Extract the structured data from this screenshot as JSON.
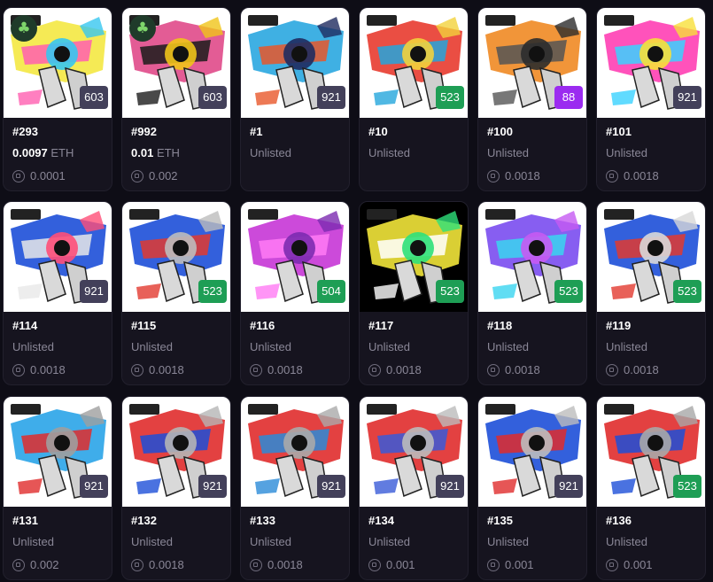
{
  "currency": "ETH",
  "colors": {
    "badge_gray": "#43405a",
    "badge_green": "#1e9e55",
    "badge_purple": "#9b2bf0",
    "accent_clover": "#7ed56b"
  },
  "cards": [
    {
      "id": "#293",
      "badge": "603",
      "badge_color": "gray",
      "price": "0.0097",
      "listed": true,
      "offer": "0.0001",
      "clover": true
    },
    {
      "id": "#992",
      "badge": "603",
      "badge_color": "gray",
      "price": "0.01",
      "listed": true,
      "offer": "0.002",
      "clover": true
    },
    {
      "id": "#1",
      "badge": "921",
      "badge_color": "gray",
      "status": "Unlisted",
      "offer": ""
    },
    {
      "id": "#10",
      "badge": "523",
      "badge_color": "green",
      "status": "Unlisted",
      "offer": ""
    },
    {
      "id": "#100",
      "badge": "88",
      "badge_color": "purple",
      "status": "Unlisted",
      "offer": "0.0018"
    },
    {
      "id": "#101",
      "badge": "921",
      "badge_color": "gray",
      "status": "Unlisted",
      "offer": "0.0018"
    },
    {
      "id": "#114",
      "badge": "921",
      "badge_color": "gray",
      "status": "Unlisted",
      "offer": "0.0018"
    },
    {
      "id": "#115",
      "badge": "523",
      "badge_color": "green",
      "status": "Unlisted",
      "offer": "0.0018"
    },
    {
      "id": "#116",
      "badge": "504",
      "badge_color": "green",
      "status": "Unlisted",
      "offer": "0.0018"
    },
    {
      "id": "#117",
      "badge": "523",
      "badge_color": "green",
      "status": "Unlisted",
      "offer": "0.0018"
    },
    {
      "id": "#118",
      "badge": "523",
      "badge_color": "green",
      "status": "Unlisted",
      "offer": "0.0018"
    },
    {
      "id": "#119",
      "badge": "523",
      "badge_color": "green",
      "status": "Unlisted",
      "offer": "0.0018"
    },
    {
      "id": "#131",
      "badge": "921",
      "badge_color": "gray",
      "status": "Unlisted",
      "offer": "0.002"
    },
    {
      "id": "#132",
      "badge": "921",
      "badge_color": "gray",
      "status": "Unlisted",
      "offer": "0.0018"
    },
    {
      "id": "#133",
      "badge": "921",
      "badge_color": "gray",
      "status": "Unlisted",
      "offer": "0.0018"
    },
    {
      "id": "#134",
      "badge": "921",
      "badge_color": "gray",
      "status": "Unlisted",
      "offer": "0.001"
    },
    {
      "id": "#135",
      "badge": "921",
      "badge_color": "gray",
      "status": "Unlisted",
      "offer": "0.001"
    },
    {
      "id": "#136",
      "badge": "523",
      "badge_color": "green",
      "status": "Unlisted",
      "offer": "0.001"
    }
  ]
}
